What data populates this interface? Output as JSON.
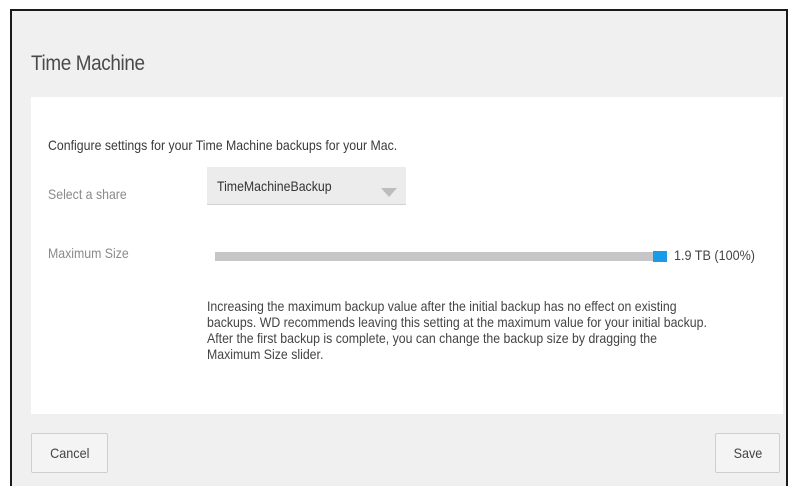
{
  "dialog": {
    "title": "Time Machine"
  },
  "settings": {
    "intro": "Configure settings for your Time Machine backups for your Mac.",
    "share": {
      "label": "Select a share",
      "selected": "TimeMachineBackup"
    },
    "max_size": {
      "label": "Maximum Size",
      "value_text": "1.9 TB (100%)",
      "level": 1.0
    },
    "note_lines": [
      "Increasing the maximum backup value after the initial backup has no effect on existing",
      "backups. WD recommends leaving this setting at the maximum value for your initial backup.",
      "After the first backup is complete, you can change the backup size by dragging the",
      "Maximum Size slider."
    ]
  },
  "buttons": {
    "cancel": "Cancel",
    "save": "Save"
  },
  "colors": {
    "accent": "#1a9be8",
    "track": "#c6c6c6",
    "dialog_bg": "#f0f0f0",
    "panel_bg": "#ffffff"
  }
}
